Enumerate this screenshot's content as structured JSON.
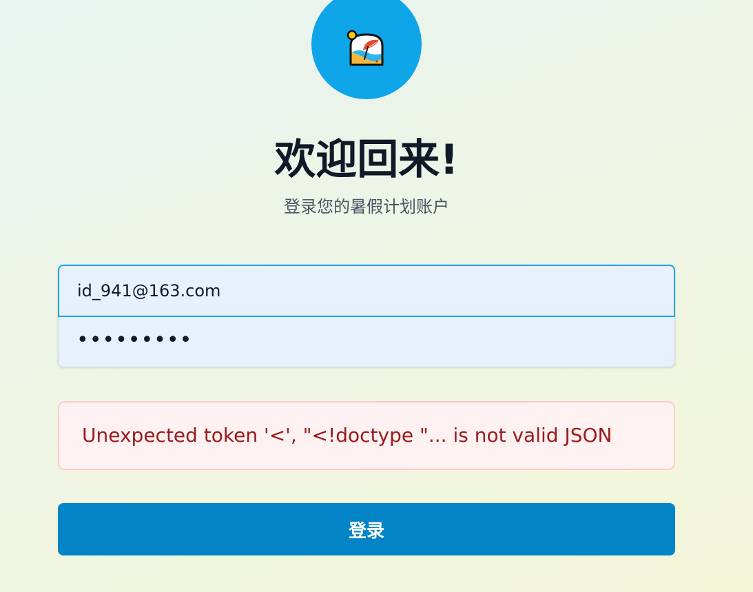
{
  "logo": {
    "icon": "beach-umbrella-icon",
    "background_color": "#0ea5e9"
  },
  "header": {
    "title": "欢迎回来!",
    "subtitle": "登录您的暑假计划账户"
  },
  "form": {
    "email_value": "id_941@163.com",
    "password_masked": "•••••••••"
  },
  "error": {
    "message": "Unexpected token '<', \"<!doctype \"... is not valid JSON"
  },
  "actions": {
    "login_label": "登录"
  },
  "colors": {
    "accent": "#0ea5e9",
    "button": "#0284c7",
    "error_text": "#991b1b",
    "error_bg": "#fef1f2",
    "error_border": "#fecaca"
  }
}
